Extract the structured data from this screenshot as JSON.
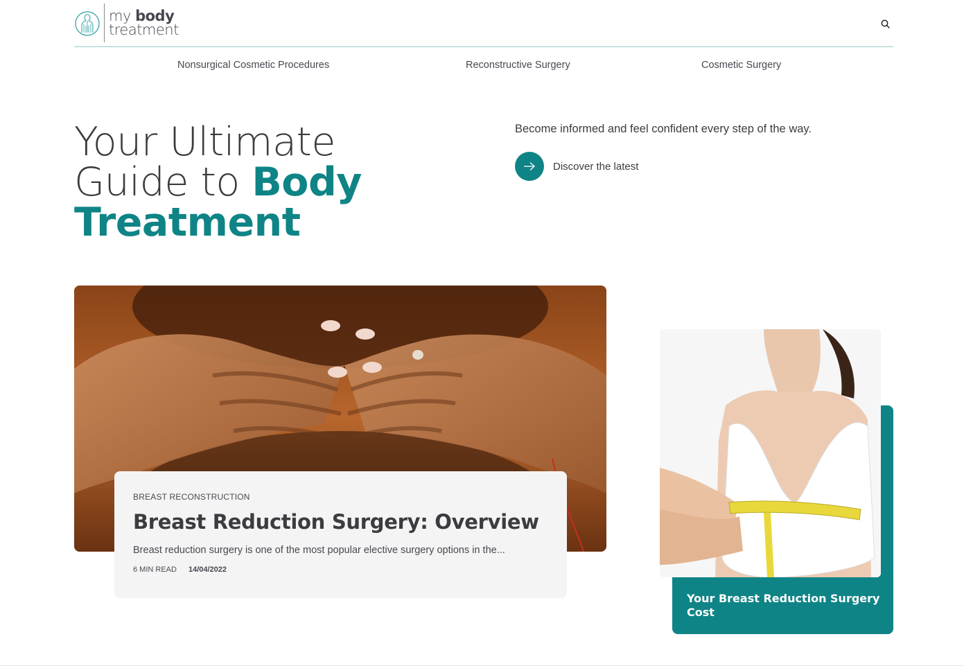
{
  "header": {
    "logo_top": "my",
    "logo_top_bold": "body",
    "logo_bottom": "treatment",
    "search_icon": "search-icon"
  },
  "nav": {
    "items": [
      {
        "label": "Nonsurgical Cosmetic Procedures"
      },
      {
        "label": "Reconstructive Surgery"
      },
      {
        "label": "Cosmetic Surgery"
      }
    ]
  },
  "hero": {
    "title_line1": "Your Ultimate",
    "title_line2": "Guide to",
    "title_accent1": "Body",
    "title_accent2": "Treatment",
    "subtitle": "Become informed and feel confident every step of the way.",
    "cta_label": "Discover the latest",
    "cta_icon": "arrow-right-icon"
  },
  "featured": {
    "category": "BREAST RECONSTRUCTION",
    "title": "Breast Reduction Surgery: Overview",
    "excerpt": "Breast reduction surgery is one of the most popular elective surgery options in the...",
    "read_time": "6 MIN READ",
    "date": "14/04/2022"
  },
  "side_article": {
    "title": "Your Breast Reduction Surgery Cost"
  },
  "colors": {
    "accent": "#0f8486",
    "text": "#3d3a40",
    "card_bg": "#f4f4f4"
  }
}
